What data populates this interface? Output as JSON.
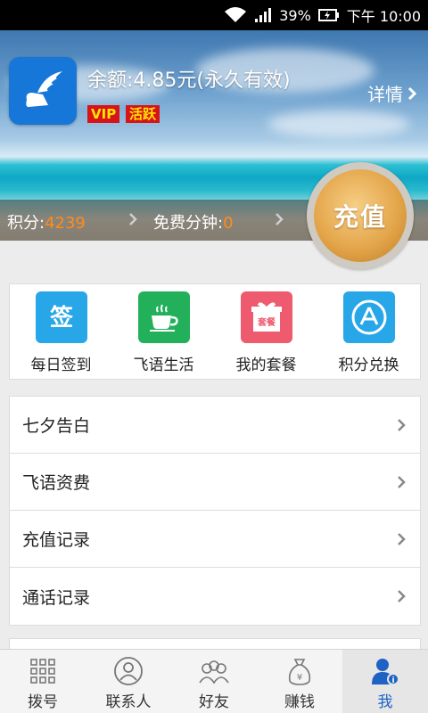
{
  "status_bar": {
    "battery": "39%",
    "time": "下午 10:00",
    "wifi_icon": "wifi-icon",
    "signal_icon": "signal-icon",
    "battery_icon": "battery-charging-icon"
  },
  "header": {
    "app_icon": "winged-shoe-icon",
    "balance": "余额:4.85元(永久有效)",
    "badges": [
      "VIP",
      "活跃"
    ],
    "details_label": "详情",
    "points_label": "积分:",
    "points_value": "4239",
    "free_minutes_label": "免费分钟:",
    "free_minutes_value": "0",
    "recharge_label": "充值"
  },
  "quick_actions": [
    {
      "label": "每日签到",
      "icon": "sign-in-icon",
      "color": "#27a6e8"
    },
    {
      "label": "飞语生活",
      "icon": "coffee-cup-icon",
      "color": "#23b05a"
    },
    {
      "label": "我的套餐",
      "icon": "gift-package-icon",
      "color": "#ee5a6e"
    },
    {
      "label": "积分兑换",
      "icon": "app-store-icon",
      "color": "#27a6e8"
    }
  ],
  "menu": [
    {
      "label": "七夕告白"
    },
    {
      "label": "飞语资费"
    },
    {
      "label": "充值记录"
    },
    {
      "label": "通话记录"
    }
  ],
  "bottom_nav": [
    {
      "label": "拨号",
      "icon": "dialpad-icon"
    },
    {
      "label": "联系人",
      "icon": "contact-icon"
    },
    {
      "label": "好友",
      "icon": "friends-icon"
    },
    {
      "label": "赚钱",
      "icon": "money-bag-icon"
    },
    {
      "label": "我",
      "icon": "profile-icon",
      "active": true
    }
  ],
  "colors": {
    "accent": "#1e63c4",
    "points": "#ff8c1a",
    "badge_bg": "#d7141a",
    "badge_text": "#ffe600"
  }
}
